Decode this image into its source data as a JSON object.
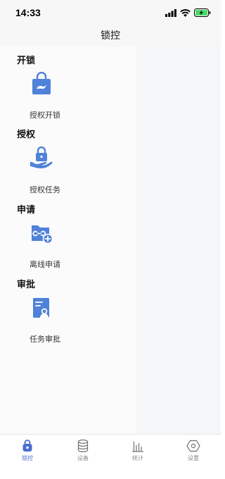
{
  "status_bar": {
    "time": "14:33",
    "icons": [
      "signal-icon",
      "wifi-icon",
      "battery-charging-icon"
    ]
  },
  "nav": {
    "title": "锁控"
  },
  "sections": [
    {
      "title": "开锁",
      "items": [
        {
          "label": "授权开锁",
          "icon": "unlock-bag-icon"
        }
      ]
    },
    {
      "title": "授权",
      "items": [
        {
          "label": "授权任务",
          "icon": "hand-lock-icon"
        }
      ]
    },
    {
      "title": "申请",
      "items": [
        {
          "label": "离线申请",
          "icon": "folder-add-icon"
        }
      ]
    },
    {
      "title": "审批",
      "items": [
        {
          "label": "任务审批",
          "icon": "document-user-icon"
        }
      ]
    }
  ],
  "tabs": [
    {
      "label": "锁控",
      "icon": "lock-icon",
      "active": true
    },
    {
      "label": "设备",
      "icon": "database-icon",
      "active": false
    },
    {
      "label": "统计",
      "icon": "bar-chart-icon",
      "active": false
    },
    {
      "label": "设置",
      "icon": "hexagon-settings-icon",
      "active": false
    }
  ],
  "colors": {
    "accent": "#4a6fd2",
    "icon_blue": "#4f82d8",
    "tab_inactive": "#8a8a8a",
    "battery_green": "#4cd964"
  }
}
